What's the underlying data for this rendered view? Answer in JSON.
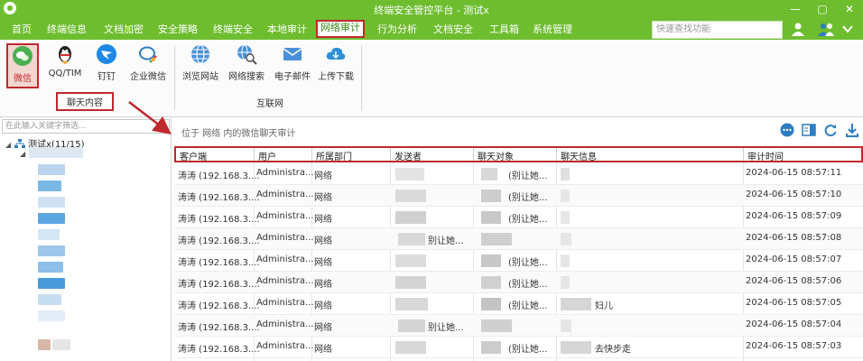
{
  "window": {
    "title": "终端安全管控平台 - 测试x",
    "controls": [
      "—",
      "▢",
      "✕"
    ]
  },
  "menu": {
    "items": [
      "首页",
      "终端信息",
      "文档加密",
      "安全策略",
      "终端安全",
      "本地审计",
      "网络审计",
      "行为分析",
      "文档安全",
      "工具箱",
      "系统管理"
    ],
    "active": "网络审计",
    "quick_search_placeholder": "快速查找功能"
  },
  "ribbon": {
    "chat_buttons": [
      "微信",
      "QQ/TIM",
      "钉钉",
      "企业微信"
    ],
    "chat_group_label": "聊天内容",
    "net_buttons": [
      "浏览网站",
      "网络搜索",
      "电子邮件",
      "上传下载"
    ],
    "net_group_label": "互联网",
    "colors": {
      "wechat": "#4caf50",
      "accent": "#c0282e"
    }
  },
  "left": {
    "filter_placeholder": "在此输入关键字筛选...",
    "root_label": "测试x(11/15)"
  },
  "main": {
    "caption": "位于 网络 内的微信聊天审计",
    "columns": [
      "客户端",
      "用户",
      "所属部门",
      "发送者",
      "聊天对象",
      "聊天信息",
      "审计时间"
    ],
    "rows": [
      {
        "client": "涛涛 (192.168.3....",
        "user": "Administra...",
        "dept": "网络",
        "sender": "",
        "partner": "(别让她...",
        "msg": "",
        "time": "2024-06-15 08:57:11"
      },
      {
        "client": "涛涛 (192.168.3....",
        "user": "Administra...",
        "dept": "网络",
        "sender": "",
        "partner": "(别让她...",
        "msg": "",
        "time": "2024-06-15 08:57:10"
      },
      {
        "client": "涛涛 (192.168.3....",
        "user": "Administra...",
        "dept": "网络",
        "sender": "",
        "partner": "(别让她...",
        "msg": "",
        "time": "2024-06-15 08:57:09"
      },
      {
        "client": "涛涛 (192.168.3....",
        "user": "Administra...",
        "dept": "网络",
        "sender": "别让她...",
        "partner": "",
        "msg": "",
        "time": "2024-06-15 08:57:08"
      },
      {
        "client": "涛涛 (192.168.3....",
        "user": "Administra...",
        "dept": "网络",
        "sender": "",
        "partner": "(别让她...",
        "msg": "",
        "time": "2024-06-15 08:57:07"
      },
      {
        "client": "涛涛 (192.168.3....",
        "user": "Administra...",
        "dept": "网络",
        "sender": "",
        "partner": "(别让她...",
        "msg": "",
        "time": "2024-06-15 08:57:06"
      },
      {
        "client": "涛涛 (192.168.3....",
        "user": "Administra...",
        "dept": "网络",
        "sender": "",
        "partner": "(别让她...",
        "msg": "妇儿",
        "time": "2024-06-15 08:57:05"
      },
      {
        "client": "涛涛 (192.168.3....",
        "user": "Administra...",
        "dept": "网络",
        "sender": "别让她...",
        "partner": "",
        "msg": "",
        "time": "2024-06-15 08:57:04"
      },
      {
        "client": "涛涛 (192.168.3....",
        "user": "Administra...",
        "dept": "网络",
        "sender": "",
        "partner": "(别让她...",
        "msg": "去快步走",
        "time": "2024-06-15 08:57:03"
      }
    ]
  }
}
